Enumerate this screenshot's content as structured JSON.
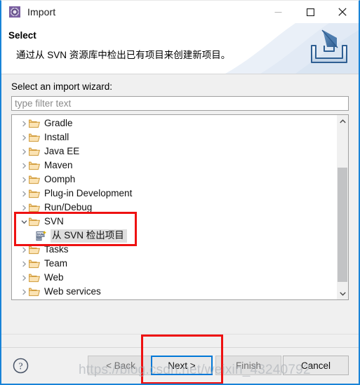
{
  "window": {
    "title": "Import",
    "icon": "eclipse-import-icon",
    "controls": {
      "minimize": "minimize-icon",
      "maximize": "maximize-icon",
      "close": "close-icon"
    }
  },
  "banner": {
    "title": "Select",
    "description": "通过从 SVN 资源库中检出已有项目来创建新项目。",
    "icon": "import-tray-arrow-icon"
  },
  "form": {
    "label": "Select an import wizard:",
    "filter_value": "",
    "filter_placeholder": "type filter text"
  },
  "tree": {
    "rows": [
      {
        "label": "Gradle",
        "level": 0,
        "expanded": false,
        "icon": "folder-icon",
        "selected": false
      },
      {
        "label": "Install",
        "level": 0,
        "expanded": false,
        "icon": "folder-icon",
        "selected": false
      },
      {
        "label": "Java EE",
        "level": 0,
        "expanded": false,
        "icon": "folder-icon",
        "selected": false
      },
      {
        "label": "Maven",
        "level": 0,
        "expanded": false,
        "icon": "folder-icon",
        "selected": false
      },
      {
        "label": "Oomph",
        "level": 0,
        "expanded": false,
        "icon": "folder-icon",
        "selected": false
      },
      {
        "label": "Plug-in Development",
        "level": 0,
        "expanded": false,
        "icon": "folder-icon",
        "selected": false
      },
      {
        "label": "Run/Debug",
        "level": 0,
        "expanded": false,
        "icon": "folder-icon",
        "selected": false
      },
      {
        "label": "SVN",
        "level": 0,
        "expanded": true,
        "icon": "folder-icon",
        "selected": false
      },
      {
        "label": "从 SVN 检出项目",
        "level": 1,
        "expanded": null,
        "icon": "svn-checkout-icon",
        "selected": true
      },
      {
        "label": "Tasks",
        "level": 0,
        "expanded": false,
        "icon": "folder-icon",
        "selected": false
      },
      {
        "label": "Team",
        "level": 0,
        "expanded": false,
        "icon": "folder-icon",
        "selected": false
      },
      {
        "label": "Web",
        "level": 0,
        "expanded": false,
        "icon": "folder-icon",
        "selected": false
      },
      {
        "label": "Web services",
        "level": 0,
        "expanded": false,
        "icon": "folder-icon",
        "selected": false
      }
    ],
    "scrollbar": {
      "up": "chevron-up-icon",
      "down": "chevron-down-icon",
      "thumb_top_pct": 22,
      "thumb_height_pct": 62
    }
  },
  "footer": {
    "help_icon": "help-question-icon",
    "buttons": {
      "back": {
        "label": "< Back",
        "state": "disabled"
      },
      "next": {
        "label": "Next >",
        "state": "focused"
      },
      "finish": {
        "label": "Finish",
        "state": "disabled"
      },
      "cancel": {
        "label": "Cancel",
        "state": "enabled"
      }
    }
  },
  "annotations": {
    "svn_highlight": "red-rectangle",
    "next_highlight": "red-rectangle",
    "watermark": "https://blog.csdn.net/weixin_43240792"
  },
  "colors": {
    "accent": "#0078d7",
    "window_border": "#1883d7",
    "annotation_red": "#ee1111",
    "folder": "#e8a33d",
    "selection": "#dedede"
  }
}
